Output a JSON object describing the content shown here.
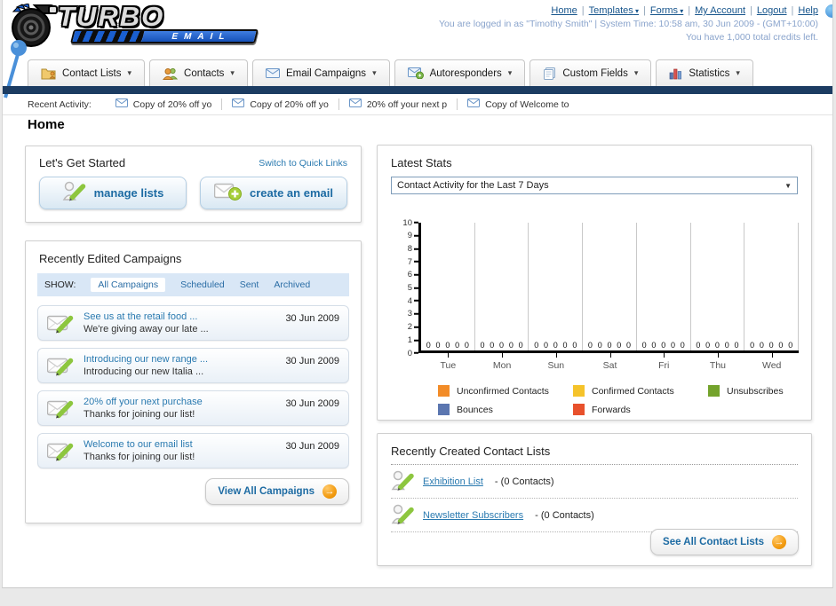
{
  "header": {
    "logo_title": "TURBO",
    "logo_subtitle": "EMAIL",
    "nav_links": [
      {
        "label": "Home",
        "dropdown": false
      },
      {
        "label": "Templates",
        "dropdown": true
      },
      {
        "label": "Forms",
        "dropdown": true
      },
      {
        "label": "My Account",
        "dropdown": false
      },
      {
        "label": "Logout",
        "dropdown": false
      },
      {
        "label": "Help",
        "dropdown": false
      }
    ],
    "login_line": "You are logged in as \"Timothy Smith\" | System Time: 10:58 am, 30 Jun 2009 - (GMT+10:00)",
    "credits_line": "You have 1,000 total credits left."
  },
  "nav_tabs": [
    {
      "label": "Contact Lists",
      "icon": "contact-lists-folder-icon"
    },
    {
      "label": "Contacts",
      "icon": "contacts-people-icon"
    },
    {
      "label": "Email Campaigns",
      "icon": "email-campaigns-envelope-icon"
    },
    {
      "label": "Autoresponders",
      "icon": "autoresponders-envelope-icon"
    },
    {
      "label": "Custom Fields",
      "icon": "custom-fields-pages-icon"
    },
    {
      "label": "Statistics",
      "icon": "statistics-bars-icon"
    }
  ],
  "recent_activity": {
    "label": "Recent Activity:",
    "items": [
      "Copy of 20% off yo",
      "Copy of 20% off yo",
      "20% off your next p",
      "Copy of Welcome to"
    ]
  },
  "page_title": "Home",
  "get_started": {
    "title": "Let's Get Started",
    "switch_link": "Switch to Quick Links",
    "buttons": [
      {
        "label": "manage lists",
        "icon": "manage-lists-icon"
      },
      {
        "label": "create an email",
        "icon": "create-email-icon"
      }
    ]
  },
  "campaigns": {
    "title": "Recently Edited Campaigns",
    "show_label": "SHOW:",
    "filters": [
      "All Campaigns",
      "Scheduled",
      "Sent",
      "Archived"
    ],
    "active_filter": "All Campaigns",
    "items": [
      {
        "title": "See us at the retail food ...",
        "subtitle": "We're giving away our late ...",
        "date": "30 Jun 2009"
      },
      {
        "title": "Introducing our new range ...",
        "subtitle": "Introducing our new Italia ...",
        "date": "30 Jun 2009"
      },
      {
        "title": "20% off your next purchase",
        "subtitle": "Thanks for joining our list!",
        "date": "30 Jun 2009"
      },
      {
        "title": "Welcome to our email list",
        "subtitle": "Thanks for joining our list!",
        "date": "30 Jun 2009"
      }
    ],
    "view_all_label": "View All Campaigns"
  },
  "stats": {
    "title": "Latest Stats",
    "period_selector": "Contact Activity for the Last 7 Days"
  },
  "chart_data": {
    "type": "bar",
    "title": "Contact Activity for the Last 7 Days",
    "categories": [
      "Tue",
      "Mon",
      "Sun",
      "Sat",
      "Fri",
      "Thu",
      "Wed"
    ],
    "series": [
      {
        "name": "Unconfirmed Contacts",
        "color": "#f28c28",
        "values": [
          0,
          0,
          0,
          0,
          0,
          0,
          0
        ]
      },
      {
        "name": "Confirmed Contacts",
        "color": "#f5c32b",
        "values": [
          0,
          0,
          0,
          0,
          0,
          0,
          0
        ]
      },
      {
        "name": "Unsubscribes",
        "color": "#74a32c",
        "values": [
          0,
          0,
          0,
          0,
          0,
          0,
          0
        ]
      },
      {
        "name": "Bounces",
        "color": "#5b76b0",
        "values": [
          0,
          0,
          0,
          0,
          0,
          0,
          0
        ]
      },
      {
        "name": "Forwards",
        "color": "#e8512c",
        "values": [
          0,
          0,
          0,
          0,
          0,
          0,
          0
        ]
      }
    ],
    "ylim": [
      0,
      10
    ],
    "yticks": [
      0,
      1,
      2,
      3,
      4,
      5,
      6,
      7,
      8,
      9,
      10
    ],
    "grid": true,
    "legend_position": "bottom"
  },
  "contact_lists": {
    "title": "Recently Created Contact Lists",
    "items": [
      {
        "name": "Exhibition List",
        "suffix": "- (0 Contacts)"
      },
      {
        "name": "Newsletter Subscribers",
        "suffix": "- (0 Contacts)"
      }
    ],
    "see_all_label": "See All Contact Lists"
  },
  "colors": {
    "navy_bar": "#1c3c62",
    "link_blue": "#2a7ab0",
    "accent_orange": "#f39c12",
    "filter_bar_bg": "#d9e7f6"
  }
}
